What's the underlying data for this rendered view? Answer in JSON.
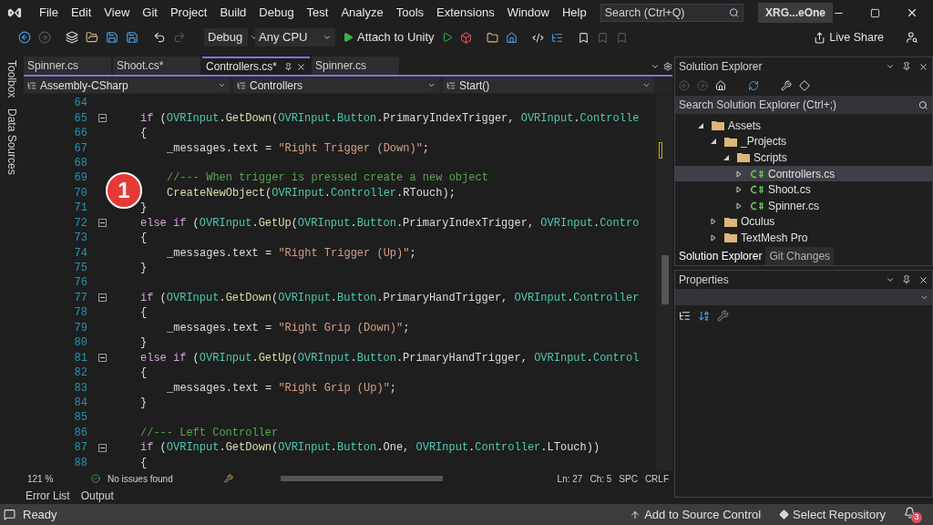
{
  "menu": [
    "File",
    "Edit",
    "View",
    "Git",
    "Project",
    "Build",
    "Debug",
    "Test",
    "Analyze",
    "Tools",
    "Extensions",
    "Window",
    "Help"
  ],
  "search": {
    "placeholder": "Search (Ctrl+Q)"
  },
  "solution_name": "XRG...eOne",
  "toolbar": {
    "configuration": "Debug",
    "platform": "Any CPU",
    "run": "Attach to Unity",
    "live_share": "Live Share"
  },
  "tabs": [
    {
      "label": "Spinner.cs",
      "selected": false
    },
    {
      "label": "Shoot.cs*",
      "selected": false
    },
    {
      "label": "Controllers.cs*",
      "selected": true
    },
    {
      "label": "Spinner.cs",
      "selected": false
    }
  ],
  "side_strip": [
    "Toolbox",
    "Data Sources"
  ],
  "nav": [
    "Assembly-CSharp",
    "Controllers",
    "Start()"
  ],
  "code": [
    {
      "n": "64",
      "fold": false
    },
    {
      "n": "65",
      "fold": true,
      "tokens": [
        {
          "kind": "kw",
          "t": "if"
        },
        {
          "kind": "p",
          "t": " ("
        },
        {
          "kind": "type",
          "t": "OVRInput"
        },
        {
          "kind": "p",
          "t": "."
        },
        {
          "kind": "fn",
          "t": "GetDown"
        },
        {
          "kind": "p",
          "t": "("
        },
        {
          "kind": "type",
          "t": "OVRInput"
        },
        {
          "kind": "p",
          "t": "."
        },
        {
          "kind": "type",
          "t": "Button"
        },
        {
          "kind": "p",
          "t": ".PrimaryIndexTrigger, "
        },
        {
          "kind": "type",
          "t": "OVRInput"
        },
        {
          "kind": "p",
          "t": "."
        },
        {
          "kind": "type",
          "t": "Controlle"
        }
      ]
    },
    {
      "n": "66",
      "fold": false,
      "tokens": [
        {
          "kind": "p",
          "t": "{"
        }
      ],
      "children": [
        {
          "n": "67",
          "fold": false,
          "tokens": [
            {
              "kind": "p",
              "t": "_messages.text = "
            },
            {
              "kind": "str",
              "t": "\"Right Trigger (Down)\""
            },
            {
              "kind": "p",
              "t": ";"
            }
          ]
        },
        {
          "n": "68",
          "fold": false
        },
        {
          "n": "69",
          "fold": false,
          "tokens": [
            {
              "kind": "cmt",
              "t": "//--- When trigger is pressed create a new object"
            }
          ]
        },
        {
          "n": "70",
          "fold": false,
          "tokens": [
            {
              "kind": "fn",
              "t": "CreateNewObject"
            },
            {
              "kind": "p",
              "t": "("
            },
            {
              "kind": "type",
              "t": "OVRInput"
            },
            {
              "kind": "p",
              "t": "."
            },
            {
              "kind": "type",
              "t": "Controller"
            },
            {
              "kind": "p",
              "t": ".RTouch);"
            }
          ]
        }
      ]
    },
    {
      "n": "71",
      "fold": false,
      "tokens": [
        {
          "kind": "p",
          "t": "}"
        }
      ]
    },
    {
      "n": "72",
      "fold": true,
      "tokens": [
        {
          "kind": "kw",
          "t": "else if"
        },
        {
          "kind": "p",
          "t": " ("
        },
        {
          "kind": "type",
          "t": "OVRInput"
        },
        {
          "kind": "p",
          "t": "."
        },
        {
          "kind": "fn",
          "t": "GetUp"
        },
        {
          "kind": "p",
          "t": "("
        },
        {
          "kind": "type",
          "t": "OVRInput"
        },
        {
          "kind": "p",
          "t": "."
        },
        {
          "kind": "type",
          "t": "Button"
        },
        {
          "kind": "p",
          "t": ".PrimaryIndexTrigger, "
        },
        {
          "kind": "type",
          "t": "OVRInput"
        },
        {
          "kind": "p",
          "t": "."
        },
        {
          "kind": "type",
          "t": "Contro"
        }
      ]
    },
    {
      "n": "73",
      "fold": false,
      "tokens": [
        {
          "kind": "p",
          "t": "{"
        }
      ],
      "children": [
        {
          "n": "74",
          "fold": false,
          "tokens": [
            {
              "kind": "p",
              "t": "_messages.text = "
            },
            {
              "kind": "str",
              "t": "\"Right Trigger (Up)\""
            },
            {
              "kind": "p",
              "t": ";"
            }
          ]
        }
      ]
    },
    {
      "n": "75",
      "fold": false,
      "tokens": [
        {
          "kind": "p",
          "t": "}"
        }
      ]
    },
    {
      "n": "76",
      "fold": false
    },
    {
      "n": "77",
      "fold": true,
      "tokens": [
        {
          "kind": "kw",
          "t": "if"
        },
        {
          "kind": "p",
          "t": " ("
        },
        {
          "kind": "type",
          "t": "OVRInput"
        },
        {
          "kind": "p",
          "t": "."
        },
        {
          "kind": "fn",
          "t": "GetDown"
        },
        {
          "kind": "p",
          "t": "("
        },
        {
          "kind": "type",
          "t": "OVRInput"
        },
        {
          "kind": "p",
          "t": "."
        },
        {
          "kind": "type",
          "t": "Button"
        },
        {
          "kind": "p",
          "t": ".PrimaryHandTrigger, "
        },
        {
          "kind": "type",
          "t": "OVRInput"
        },
        {
          "kind": "p",
          "t": "."
        },
        {
          "kind": "type",
          "t": "Controller"
        }
      ]
    },
    {
      "n": "78",
      "fold": false,
      "tokens": [
        {
          "kind": "p",
          "t": "{"
        }
      ],
      "children": [
        {
          "n": "79",
          "fold": false,
          "tokens": [
            {
              "kind": "p",
              "t": "_messages.text = "
            },
            {
              "kind": "str",
              "t": "\"Right Grip (Down)\""
            },
            {
              "kind": "p",
              "t": ";"
            }
          ]
        }
      ]
    },
    {
      "n": "80",
      "fold": false,
      "tokens": [
        {
          "kind": "p",
          "t": "}"
        }
      ]
    },
    {
      "n": "81",
      "fold": true,
      "tokens": [
        {
          "kind": "kw",
          "t": "else if"
        },
        {
          "kind": "p",
          "t": " ("
        },
        {
          "kind": "type",
          "t": "OVRInput"
        },
        {
          "kind": "p",
          "t": "."
        },
        {
          "kind": "fn",
          "t": "GetUp"
        },
        {
          "kind": "p",
          "t": "("
        },
        {
          "kind": "type",
          "t": "OVRInput"
        },
        {
          "kind": "p",
          "t": "."
        },
        {
          "kind": "type",
          "t": "Button"
        },
        {
          "kind": "p",
          "t": ".PrimaryHandTrigger, "
        },
        {
          "kind": "type",
          "t": "OVRInput"
        },
        {
          "kind": "p",
          "t": "."
        },
        {
          "kind": "type",
          "t": "Control"
        }
      ]
    },
    {
      "n": "82",
      "fold": false,
      "tokens": [
        {
          "kind": "p",
          "t": "{"
        }
      ],
      "children": [
        {
          "n": "83",
          "fold": false,
          "tokens": [
            {
              "kind": "p",
              "t": "_messages.text = "
            },
            {
              "kind": "str",
              "t": "\"Right Grip (Up)\""
            },
            {
              "kind": "p",
              "t": ";"
            }
          ]
        }
      ]
    },
    {
      "n": "84",
      "fold": false,
      "tokens": [
        {
          "kind": "p",
          "t": "}"
        }
      ]
    },
    {
      "n": "85",
      "fold": false
    },
    {
      "n": "86",
      "fold": false,
      "tokens": [
        {
          "kind": "cmt",
          "t": "//--- Left Controller"
        }
      ]
    },
    {
      "n": "87",
      "fold": true,
      "tokens": [
        {
          "kind": "kw",
          "t": "if"
        },
        {
          "kind": "p",
          "t": " ("
        },
        {
          "kind": "type",
          "t": "OVRInput"
        },
        {
          "kind": "p",
          "t": "."
        },
        {
          "kind": "fn",
          "t": "GetDown"
        },
        {
          "kind": "p",
          "t": "("
        },
        {
          "kind": "type",
          "t": "OVRInput"
        },
        {
          "kind": "p",
          "t": "."
        },
        {
          "kind": "type",
          "t": "Button"
        },
        {
          "kind": "p",
          "t": ".One, "
        },
        {
          "kind": "type",
          "t": "OVRInput"
        },
        {
          "kind": "p",
          "t": "."
        },
        {
          "kind": "type",
          "t": "Controller"
        },
        {
          "kind": "p",
          "t": ".LTouch))"
        }
      ]
    },
    {
      "n": "88",
      "fold": false,
      "tokens": [
        {
          "kind": "p",
          "t": "{"
        }
      ]
    }
  ],
  "annotation": "1",
  "editor_status": {
    "zoom": "121 %",
    "issues": "No issues found",
    "line": "Ln: 27",
    "col": "Ch: 5",
    "indent": "SPC",
    "eol": "CRLF"
  },
  "solution_explorer": {
    "title": "Solution Explorer",
    "search": {
      "placeholder": "Search Solution Explorer (Ctrl+;)"
    },
    "tree": [
      {
        "label": "Assets",
        "kind": "folder",
        "expanded": true,
        "selected": false,
        "children": [
          {
            "label": "_Projects",
            "kind": "folder",
            "expanded": true,
            "selected": false,
            "children": [
              {
                "label": "Scripts",
                "kind": "folder",
                "expanded": true,
                "selected": false,
                "children": [
                  {
                    "label": "Controllers.cs",
                    "kind": "csharp",
                    "expanded": false,
                    "selected": true
                  },
                  {
                    "label": "Shoot.cs",
                    "kind": "csharp",
                    "expanded": false,
                    "selected": false
                  },
                  {
                    "label": "Spinner.cs",
                    "kind": "csharp",
                    "expanded": false,
                    "selected": false
                  }
                ]
              }
            ]
          },
          {
            "label": "Oculus",
            "kind": "folder",
            "expanded": false,
            "selected": false
          },
          {
            "label": "TextMesh Pro",
            "kind": "folder",
            "expanded": false,
            "selected": false
          }
        ]
      }
    ],
    "tabs": [
      {
        "label": "Solution Explorer",
        "selected": true
      },
      {
        "label": "Git Changes",
        "selected": false
      }
    ]
  },
  "properties": {
    "title": "Properties"
  },
  "bottom_tabs": [
    "Error List",
    "Output"
  ],
  "status_bar": {
    "state": "Ready",
    "source_control": "Add to Source Control",
    "repository": "Select Repository",
    "notifications": "3"
  }
}
